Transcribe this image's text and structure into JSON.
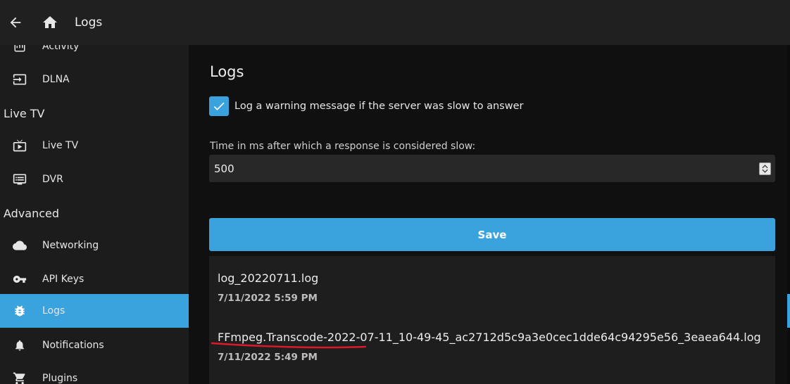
{
  "header": {
    "title": "Logs"
  },
  "sidebar": {
    "items": [
      {
        "label": "Activity",
        "icon": "activity-icon"
      },
      {
        "label": "DLNA",
        "icon": "input-icon"
      },
      {
        "label": "Live TV",
        "icon": "live-tv-icon"
      },
      {
        "label": "DVR",
        "icon": "dvr-icon"
      },
      {
        "label": "Networking",
        "icon": "cloud-icon"
      },
      {
        "label": "API Keys",
        "icon": "key-icon"
      },
      {
        "label": "Logs",
        "icon": "bug-icon",
        "active": true
      },
      {
        "label": "Notifications",
        "icon": "bell-icon"
      },
      {
        "label": "Plugins",
        "icon": "cart-icon"
      }
    ],
    "sections": [
      "Live TV",
      "Advanced"
    ]
  },
  "main": {
    "title": "Logs",
    "slow_warning": {
      "label": "Log a warning message if the server was slow to answer",
      "checked": true
    },
    "slow_threshold": {
      "label": "Time in ms after which a response is considered slow:",
      "value": "500"
    },
    "save_label": "Save",
    "logs": [
      {
        "name": "log_20220711.log",
        "date": "7/11/2022 5:59 PM"
      },
      {
        "name": "FFmpeg.Transcode-2022-07-11_10-49-45_ac2712d5c9a3e0cec1dde64c94295e56_3eaea644.log",
        "date": "7/11/2022 5:49 PM"
      }
    ]
  },
  "colors": {
    "accent": "#3aa2dc",
    "annotation": "#e0192a",
    "topbar": "#202020",
    "sidebar": "#1c1c1c"
  }
}
